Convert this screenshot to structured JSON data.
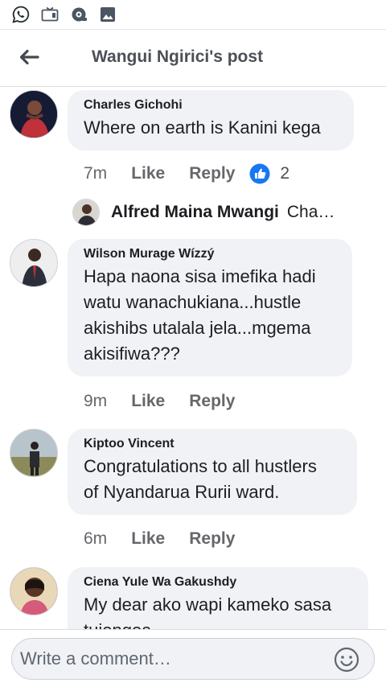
{
  "status_bar": {
    "icons": [
      "whatsapp-icon",
      "media-icon",
      "camera-lens-icon",
      "gallery-icon"
    ]
  },
  "header": {
    "title": "Wangui Ngirici's post",
    "back_icon": "arrow-left-icon"
  },
  "comments": [
    {
      "author": "Charles Gichohi",
      "lines": [
        "Where on earth is Kanini kega"
      ],
      "time": "7m",
      "like_label": "Like",
      "reply_label": "Reply",
      "reaction_icon": "thumbs-up-icon",
      "reaction_count": "2",
      "reply_preview": {
        "author": "Alfred Maina Mwangi",
        "text": "Cha…"
      }
    },
    {
      "author": "Wilson Murage Wízzý",
      "lines": [
        "Hapa naona sisa imefika hadi",
        "watu wanachukiana...hustle",
        "akishibs utalala jela...mgema",
        "akisifiwa???"
      ],
      "time": "9m",
      "like_label": "Like",
      "reply_label": "Reply"
    },
    {
      "author": "Kiptoo Vincent",
      "lines": [
        "Congratulations to all hustlers",
        "of Nyandarua Rurii ward."
      ],
      "time": "6m",
      "like_label": "Like",
      "reply_label": "Reply"
    },
    {
      "author": "Ciena Yule Wa Gakushdy",
      "lines": [
        "My dear ako wapi kameko sasa",
        "tuiongoa"
      ],
      "time": "",
      "like_label": "",
      "reply_label": ""
    }
  ],
  "composer": {
    "placeholder": "Write a comment…",
    "emoji_icon": "smiley-icon"
  },
  "colors": {
    "bubble": "#f0f2f5",
    "action_text": "#65676b",
    "like_blue": "#1877f2",
    "whatsapp_green": "#25d366",
    "status_icon": "#4b5563"
  }
}
